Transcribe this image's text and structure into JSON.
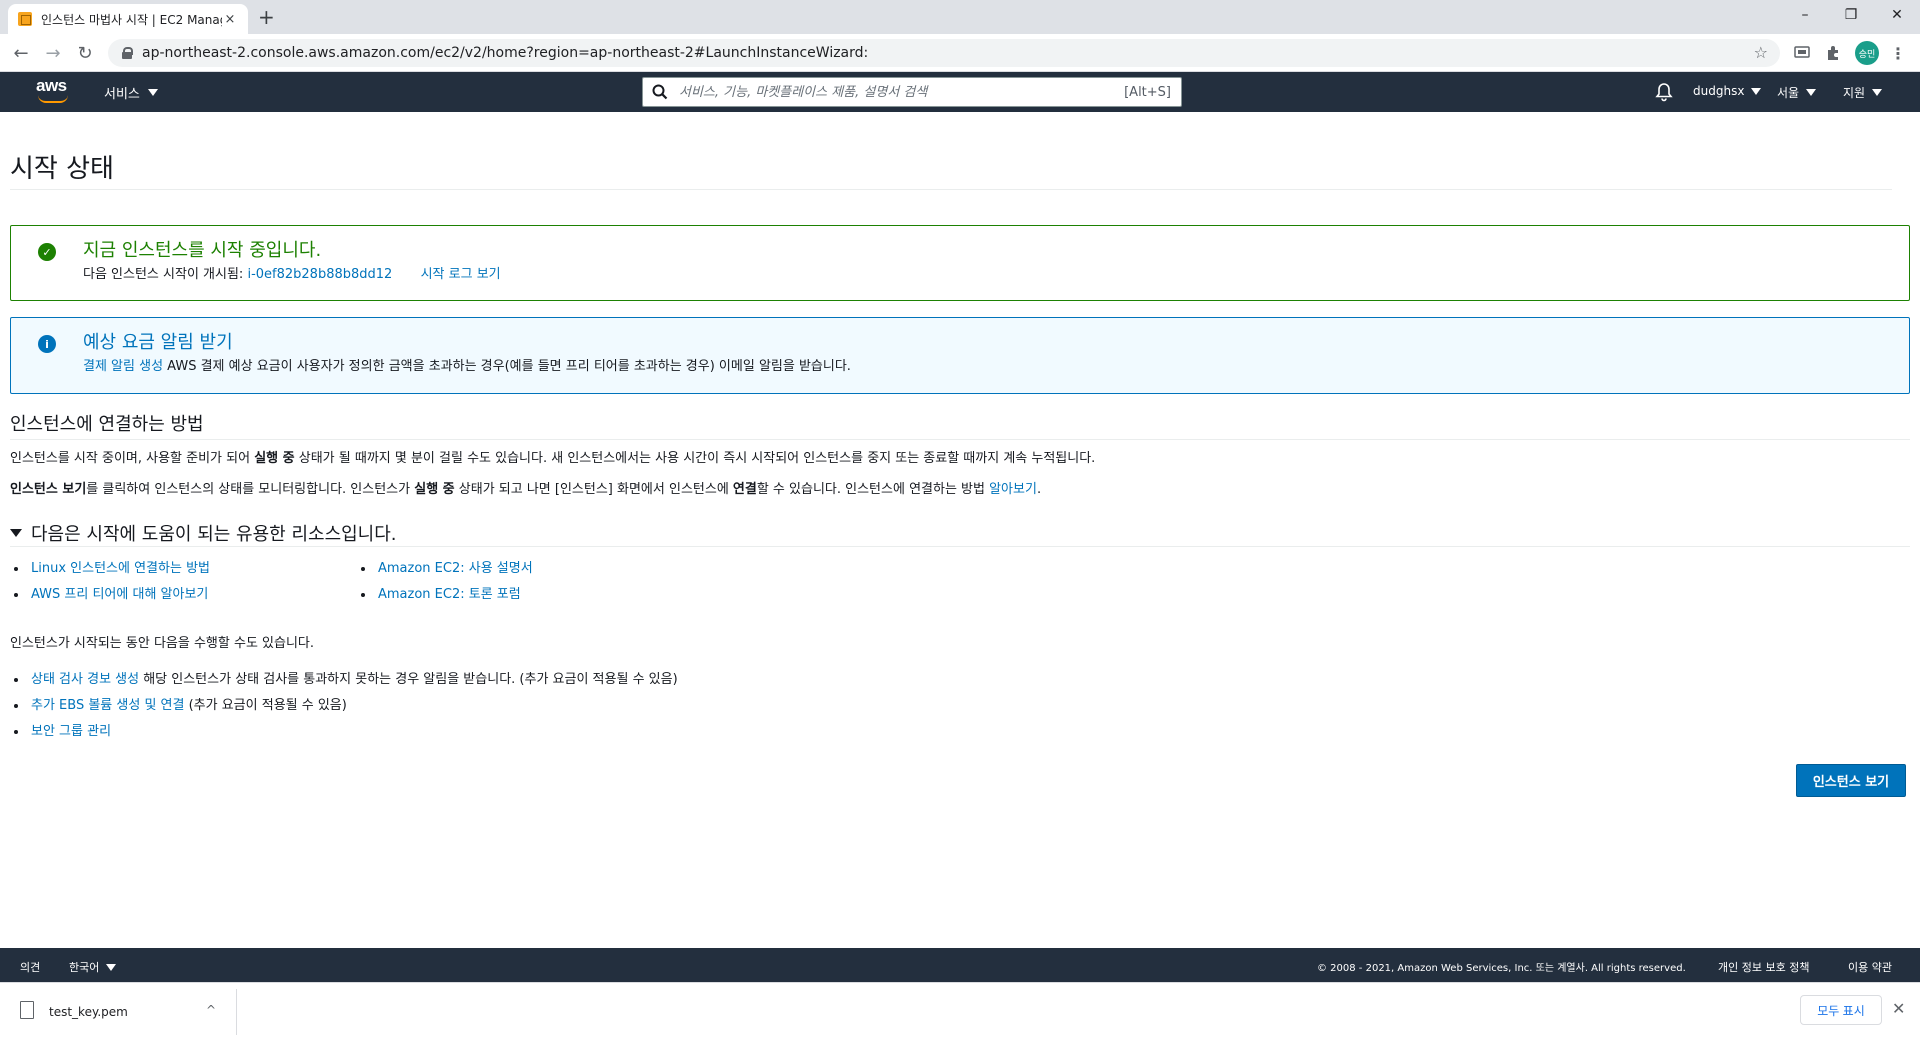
{
  "browser": {
    "tab_title": "인스턴스 마법사 시작 | EC2 Management Console",
    "tab_close": "×",
    "new_tab": "+",
    "url": "ap-northeast-2.console.aws.amazon.com/ec2/v2/home?region=ap-northeast-2#LaunchInstanceWizard:",
    "profile_label": "승민",
    "win_minimize": "–",
    "win_restore": "❐",
    "win_close": "✕",
    "back": "←",
    "forward": "→",
    "reload": "↻",
    "bookmark": "☆"
  },
  "awsnav": {
    "logo": "aws",
    "services": "서비스",
    "search_placeholder": "서비스, 기능, 마켓플레이스 제품, 설명서 검색",
    "search_shortcut": "[Alt+S]",
    "user": "dudghsx",
    "region": "서울",
    "support": "지원"
  },
  "page": {
    "title": "시작 상태",
    "success_alert": {
      "heading": "지금 인스턴스를 시작 중입니다.",
      "body_prefix": "다음 인스턴스 시작이 개시됨:",
      "instance_id": "i-0ef82b28b88b8dd12",
      "log_link": "시작 로그 보기"
    },
    "info_alert": {
      "heading": "예상 요금 알림 받기",
      "link": "결제 알림 생성",
      "body": "AWS 결제 예상 요금이 사용자가 정의한 금액을 초과하는 경우(예를 들면 프리 티어를 초과하는 경우) 이메일 알림을 받습니다."
    },
    "connect_section": {
      "heading": "인스턴스에 연결하는 방법",
      "p1_a": "인스턴스를 시작 중이며, 사용할 준비가 되어 ",
      "p1_b": "실행 중",
      "p1_c": " 상태가 될 때까지 몇 분이 걸릴 수도 있습니다. 새 인스턴스에서는 사용 시간이 즉시 시작되어 인스턴스를 중지 또는 종료할 때까지 계속 누적됩니다.",
      "p2_a": "인스턴스 보기",
      "p2_b": "를 클릭하여 인스턴스의 상태를 모니터링합니다. 인스턴스가 ",
      "p2_c": "실행 중",
      "p2_d": " 상태가 되고 나면 [인스턴스] 화면에서 인스턴스에 ",
      "p2_e": "연결",
      "p2_f": "할 수 있습니다. 인스턴스에 연결하는 방법 ",
      "p2_link": "알아보기",
      "p2_g": "."
    },
    "resources": {
      "heading": "다음은 시작에 도움이 되는 유용한 리소스입니다.",
      "col1": [
        "Linux 인스턴스에 연결하는 방법",
        "AWS 프리 티어에 대해 알아보기"
      ],
      "col2": [
        "Amazon EC2: 사용 설명서",
        "Amazon EC2: 토론 포럼"
      ]
    },
    "while_launch": {
      "intro": "인스턴스가 시작되는 동안 다음을 수행할 수도 있습니다.",
      "items": [
        {
          "link": "상태 검사 경보 생성",
          "text": " 해당 인스턴스가 상태 검사를 통과하지 못하는 경우 알림을 받습니다. (추가 요금이 적용될 수 있음)"
        },
        {
          "link": "추가 EBS 볼륨 생성 및 연결",
          "text": " (추가 요금이 적용될 수 있음)"
        },
        {
          "link": "보안 그룹 관리",
          "text": ""
        }
      ]
    },
    "view_instances_button": "인스턴스 보기"
  },
  "footer": {
    "feedback": "의견",
    "language": "한국어",
    "copyright": "© 2008 - 2021, Amazon Web Services, Inc. 또는 계열사. All rights reserved.",
    "privacy": "개인 정보 보호 정책",
    "terms": "이용 약관"
  },
  "downloads": {
    "file_name": "test_key.pem",
    "show_all": "모두 표시",
    "close": "✕",
    "chevron": "^"
  },
  "colors": {
    "aws_nav": "#232f3e",
    "success": "#1d8102",
    "info": "#0073bb",
    "link": "#0073bb",
    "accent_orange": "#ff9900"
  }
}
